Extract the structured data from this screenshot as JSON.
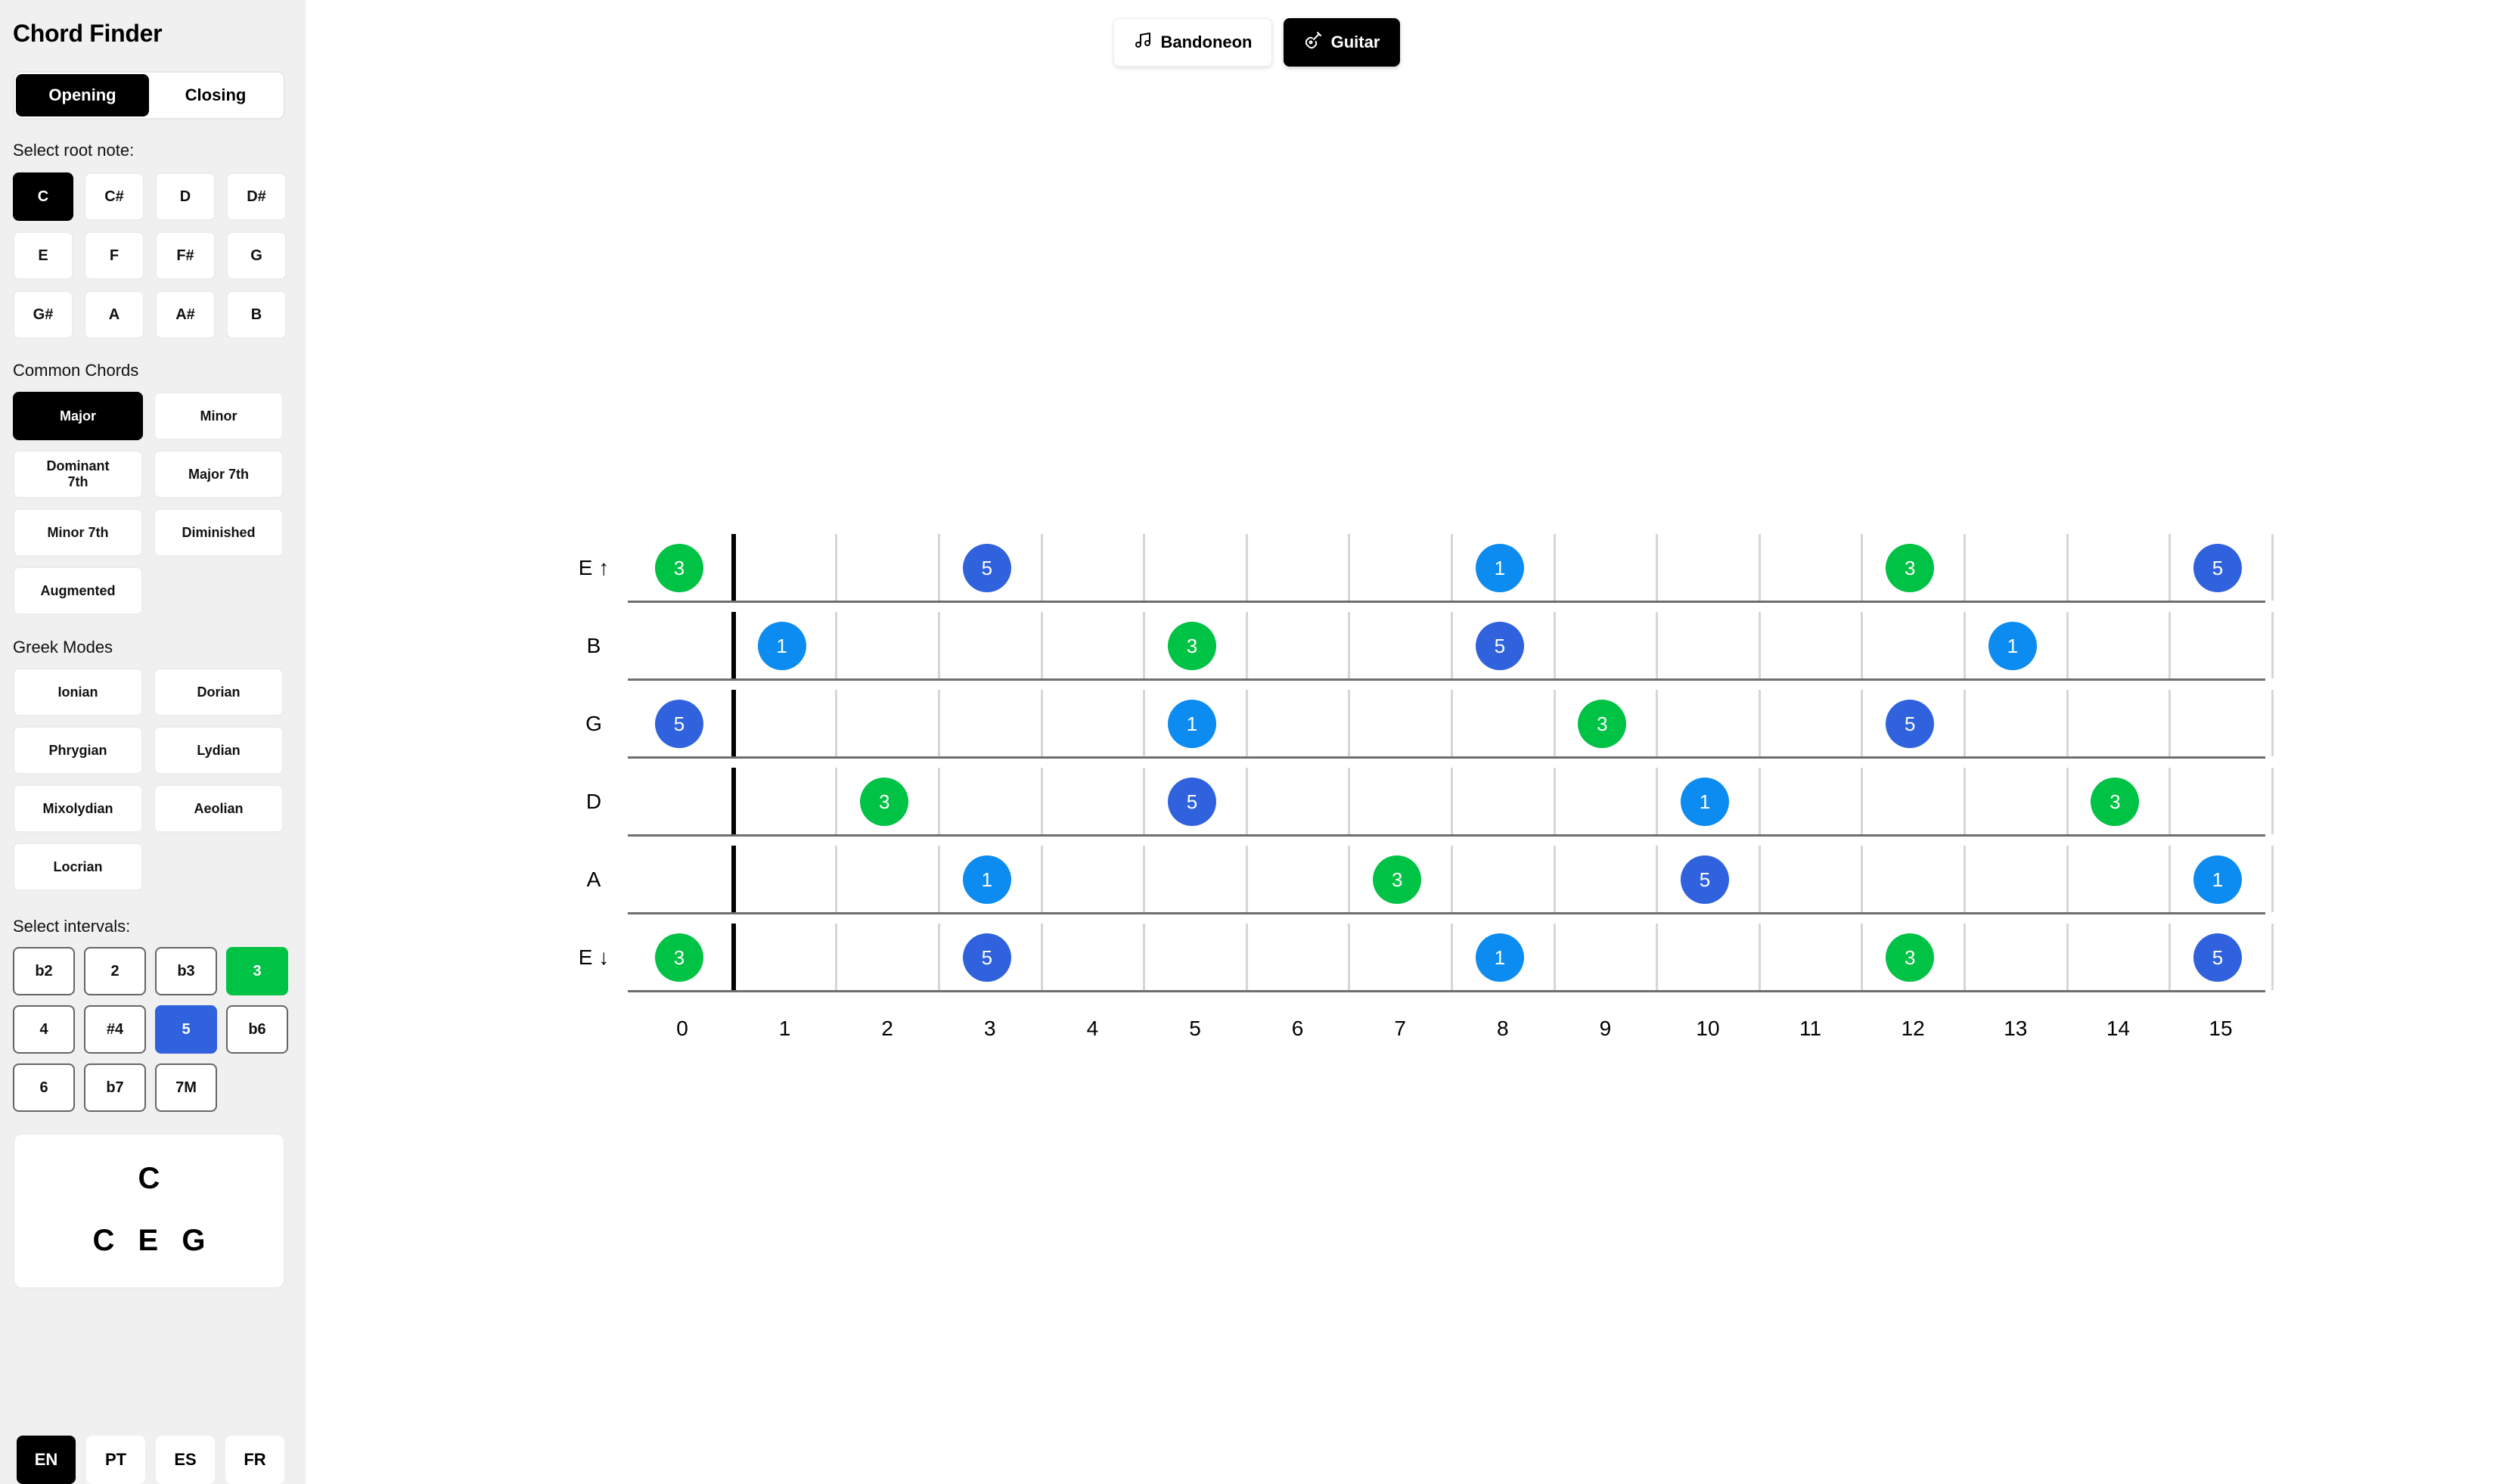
{
  "app": {
    "title": "Chord Finder"
  },
  "mode_toggle": [
    {
      "label": "Opening",
      "active": true
    },
    {
      "label": "Closing",
      "active": false
    }
  ],
  "root_section": {
    "label": "Select root note:"
  },
  "root_notes": [
    {
      "label": "C",
      "active": true
    },
    {
      "label": "C#"
    },
    {
      "label": "D"
    },
    {
      "label": "D#"
    },
    {
      "label": "E"
    },
    {
      "label": "F"
    },
    {
      "label": "F#"
    },
    {
      "label": "G"
    },
    {
      "label": "G#"
    },
    {
      "label": "A"
    },
    {
      "label": "A#"
    },
    {
      "label": "B"
    }
  ],
  "chords_section": {
    "label": "Common Chords"
  },
  "chords": [
    {
      "label": "Major",
      "active": true
    },
    {
      "label": "Minor"
    },
    {
      "label": "Dominant 7th"
    },
    {
      "label": "Major 7th"
    },
    {
      "label": "Minor 7th"
    },
    {
      "label": "Diminished"
    },
    {
      "label": "Augmented"
    }
  ],
  "modes_section": {
    "label": "Greek Modes"
  },
  "modes": [
    {
      "label": "Ionian"
    },
    {
      "label": "Dorian"
    },
    {
      "label": "Phrygian"
    },
    {
      "label": "Lydian"
    },
    {
      "label": "Mixolydian"
    },
    {
      "label": "Aeolian"
    },
    {
      "label": "Locrian"
    }
  ],
  "intervals_section": {
    "label": "Select intervals:"
  },
  "intervals": [
    {
      "label": "b2"
    },
    {
      "label": "2"
    },
    {
      "label": "b3"
    },
    {
      "label": "3",
      "state": "green"
    },
    {
      "label": "4"
    },
    {
      "label": "#4"
    },
    {
      "label": "5",
      "state": "blue"
    },
    {
      "label": "b6",
      "outlined": true
    },
    {
      "label": "6"
    },
    {
      "label": "b7"
    },
    {
      "label": "7M"
    }
  ],
  "chord_result": {
    "name": "C",
    "notes": [
      "C",
      "E",
      "G"
    ]
  },
  "languages": [
    {
      "label": "EN",
      "active": true
    },
    {
      "label": "PT"
    },
    {
      "label": "ES"
    },
    {
      "label": "FR"
    }
  ],
  "instruments": [
    {
      "label": "Bandoneon",
      "icon": "music-note-icon",
      "active": false
    },
    {
      "label": "Guitar",
      "icon": "guitar-icon",
      "active": true
    }
  ],
  "interval_colors": {
    "1": "#0c8cf0",
    "3": "#00c244",
    "5": "#2f62dc"
  },
  "fretboard": {
    "fret_numbers": [
      "0",
      "1",
      "2",
      "3",
      "4",
      "5",
      "6",
      "7",
      "8",
      "9",
      "10",
      "11",
      "12",
      "13",
      "14",
      "15"
    ],
    "strings": [
      {
        "label": "E ↑",
        "markers": [
          {
            "fret": 0,
            "interval": "3"
          },
          {
            "fret": 3,
            "interval": "5"
          },
          {
            "fret": 8,
            "interval": "1"
          },
          {
            "fret": 12,
            "interval": "3"
          },
          {
            "fret": 15,
            "interval": "5"
          }
        ]
      },
      {
        "label": "B",
        "markers": [
          {
            "fret": 1,
            "interval": "1"
          },
          {
            "fret": 5,
            "interval": "3"
          },
          {
            "fret": 8,
            "interval": "5"
          },
          {
            "fret": 13,
            "interval": "1"
          }
        ]
      },
      {
        "label": "G",
        "markers": [
          {
            "fret": 0,
            "interval": "5"
          },
          {
            "fret": 5,
            "interval": "1"
          },
          {
            "fret": 9,
            "interval": "3"
          },
          {
            "fret": 12,
            "interval": "5"
          }
        ]
      },
      {
        "label": "D",
        "markers": [
          {
            "fret": 2,
            "interval": "3"
          },
          {
            "fret": 5,
            "interval": "5"
          },
          {
            "fret": 10,
            "interval": "1"
          },
          {
            "fret": 14,
            "interval": "3"
          }
        ]
      },
      {
        "label": "A",
        "markers": [
          {
            "fret": 3,
            "interval": "1"
          },
          {
            "fret": 7,
            "interval": "3"
          },
          {
            "fret": 10,
            "interval": "5"
          },
          {
            "fret": 15,
            "interval": "1"
          }
        ]
      },
      {
        "label": "E ↓",
        "markers": [
          {
            "fret": 0,
            "interval": "3"
          },
          {
            "fret": 3,
            "interval": "5"
          },
          {
            "fret": 8,
            "interval": "1"
          },
          {
            "fret": 12,
            "interval": "3"
          },
          {
            "fret": 15,
            "interval": "5"
          }
        ]
      }
    ]
  }
}
